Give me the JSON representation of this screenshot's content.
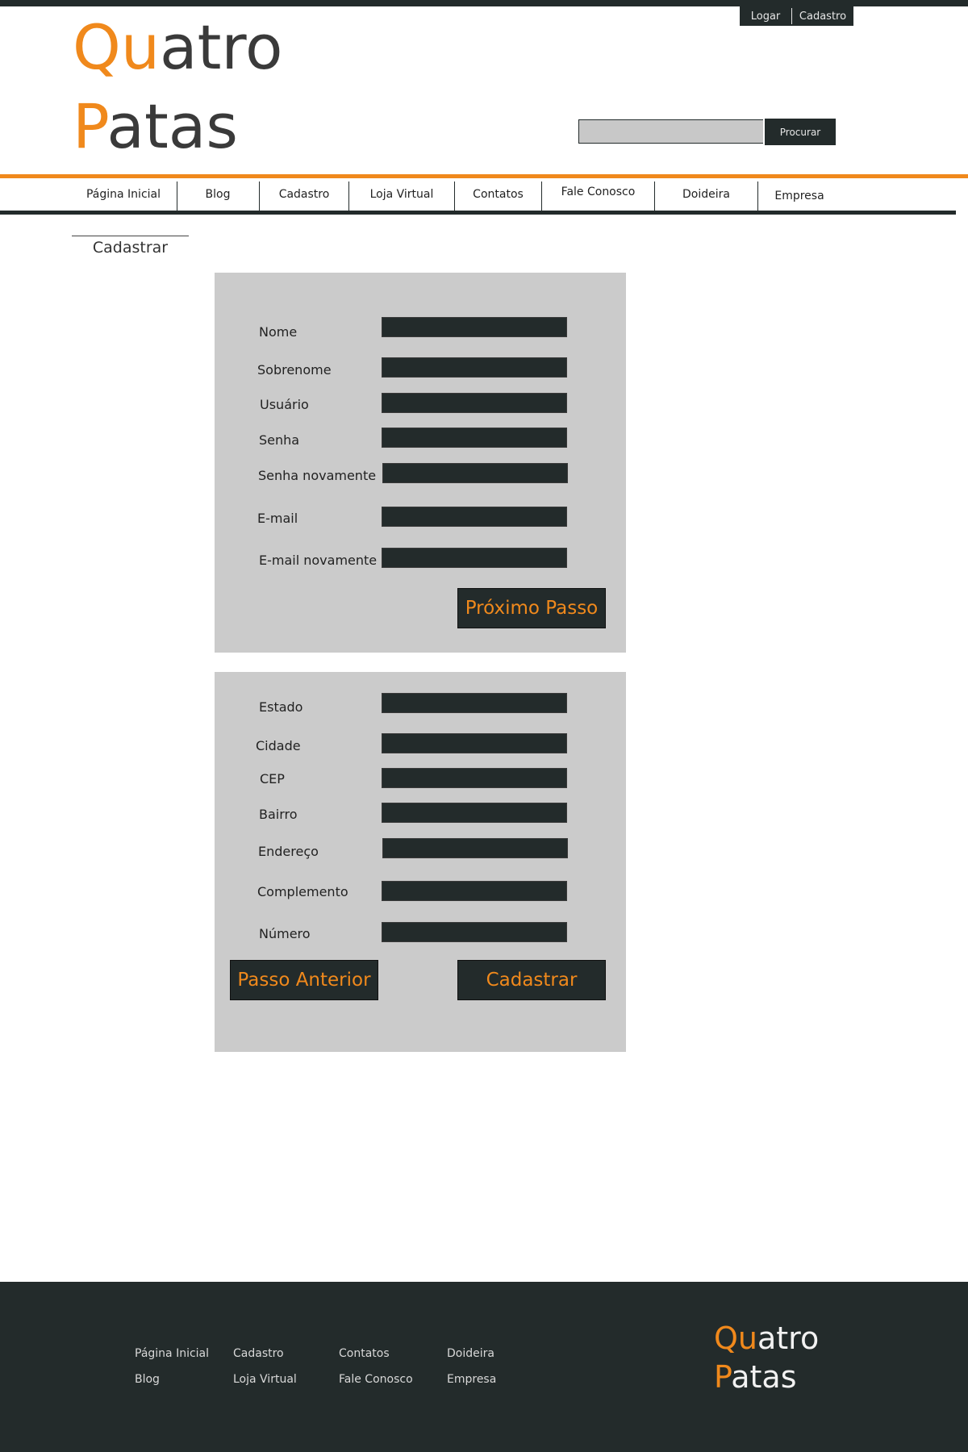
{
  "auth": {
    "login": "Logar",
    "signup": "Cadastro"
  },
  "logo": {
    "line1_accent": "Qu",
    "line1_rest": "atro",
    "line2_accent": "P",
    "line2_rest": "atas"
  },
  "search": {
    "value": "",
    "button": "Procurar"
  },
  "nav": {
    "items": [
      "Página Inicial",
      "Blog",
      "Cadastro",
      "Loja Virtual",
      "Contatos",
      "Fale Conosco",
      "Doideira",
      "Empresa"
    ]
  },
  "page_title": "Cadastrar",
  "step1": {
    "fields": [
      "Nome",
      "Sobrenome",
      "Usuário",
      "Senha",
      "Senha novamente",
      "E-mail",
      "E-mail novamente"
    ],
    "next_button": "Próximo Passo"
  },
  "step2": {
    "fields": [
      "Estado",
      "Cidade",
      "CEP",
      "Bairro",
      "Endereço",
      "Complemento",
      "Número"
    ],
    "back_button": "Passo Anterior",
    "submit_button": "Cadastrar"
  },
  "footer": {
    "columns": [
      [
        "Página Inicial",
        "Blog"
      ],
      [
        "Cadastro",
        "Loja Virtual"
      ],
      [
        "Contatos",
        "Fale Conosco"
      ],
      [
        "Doideira",
        "Empresa"
      ]
    ],
    "logo": {
      "line1_accent": "Qu",
      "line1_rest": "atro",
      "line2_accent": "P",
      "line2_rest": "atas"
    }
  },
  "colors": {
    "accent": "#f0891c",
    "dark": "#232b2b",
    "panel": "#cbcbcb"
  }
}
